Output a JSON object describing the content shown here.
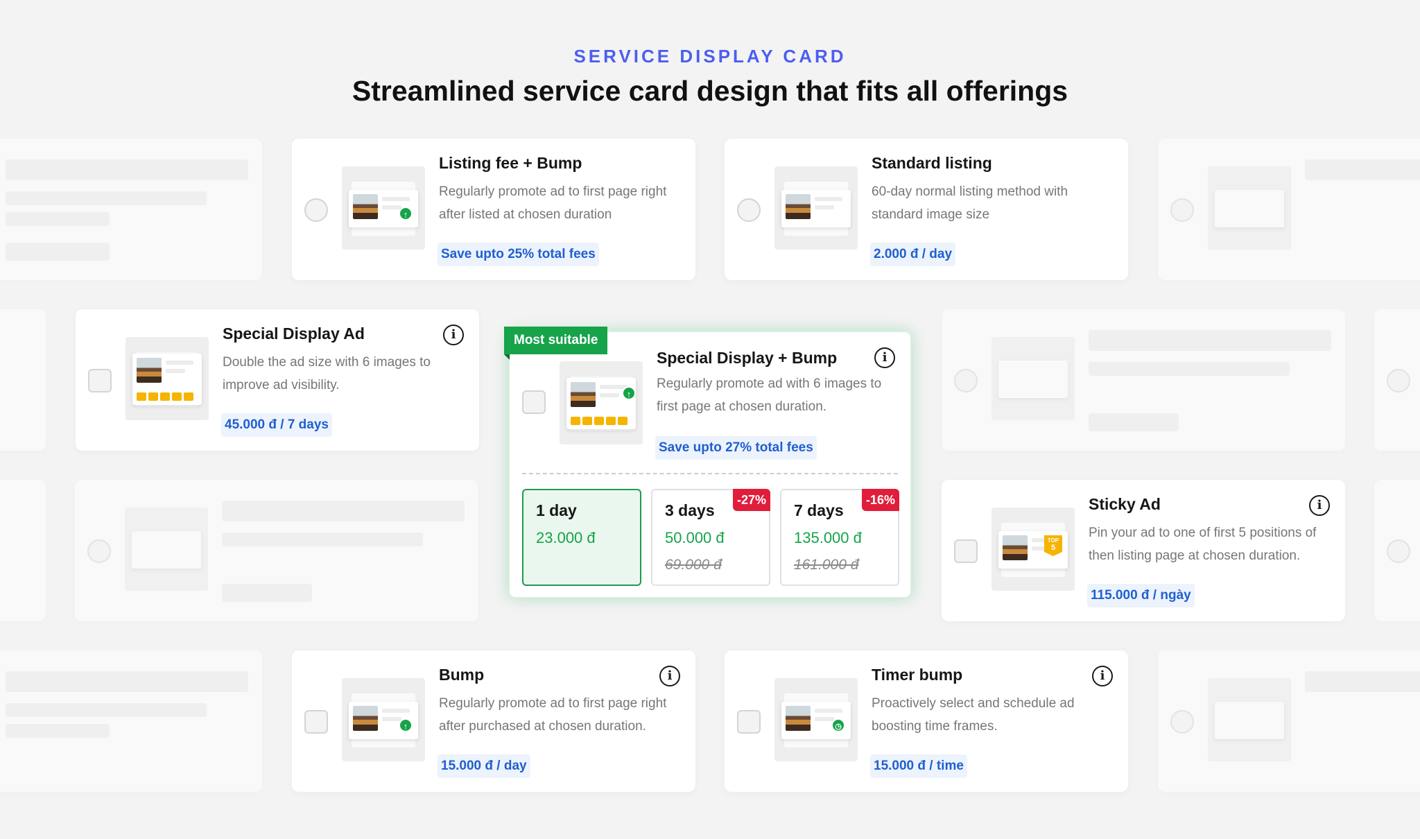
{
  "header": {
    "eyebrow": "SERVICE DISPLAY CARD",
    "headline": "Streamlined service card design that fits all offerings"
  },
  "cards": {
    "listing_bump": {
      "title": "Listing fee + Bump",
      "description": "Regularly promote ad to first page right after listed at chosen duration",
      "price": "Save upto 25% total fees"
    },
    "standard": {
      "title": "Standard listing",
      "description": "60-day normal listing method with standard image size",
      "price": "2.000 đ / day"
    },
    "special_display": {
      "title": "Special Display Ad",
      "description": "Double the ad size with 6 images to improve ad visibility.",
      "price": "45.000 đ / 7 days"
    },
    "special_bump": {
      "badge": "Most suitable",
      "title": "Special Display + Bump",
      "description": "Regularly promote ad with 6 images to first page at chosen duration.",
      "price": "Save upto 27% total fees",
      "options": [
        {
          "label": "1 day",
          "price": "23.000 đ",
          "old_price": "",
          "discount": "",
          "selected": true
        },
        {
          "label": "3 days",
          "price": "50.000 đ",
          "old_price": "69.000 đ",
          "discount": "-27%",
          "selected": false
        },
        {
          "label": "7 days",
          "price": "135.000 đ",
          "old_price": "161.000 đ",
          "discount": "-16%",
          "selected": false
        }
      ]
    },
    "sticky": {
      "title": "Sticky Ad",
      "description": "Pin your ad to one of first 5 positions of then listing page at chosen duration.",
      "price": "115.000 đ / ngày",
      "top_badge": "TOP",
      "top_number": "5"
    },
    "bump": {
      "title": "Bump",
      "description": "Regularly promote ad to first page right after purchased at chosen duration.",
      "price": "15.000 đ / day"
    },
    "timer_bump": {
      "title": "Timer bump",
      "description": "Proactively select and schedule ad boosting time frames.",
      "price": "15.000 đ / time"
    }
  },
  "colors": {
    "accent": "#4c5ef0",
    "price_blue": "#1f5fcf",
    "green": "#16a34a",
    "discount_red": "#e11d3b",
    "star_yellow": "#f5b400"
  },
  "icons": [
    "info-icon",
    "arrow-up-icon",
    "clock-icon",
    "image-icon",
    "top-badge-icon"
  ]
}
